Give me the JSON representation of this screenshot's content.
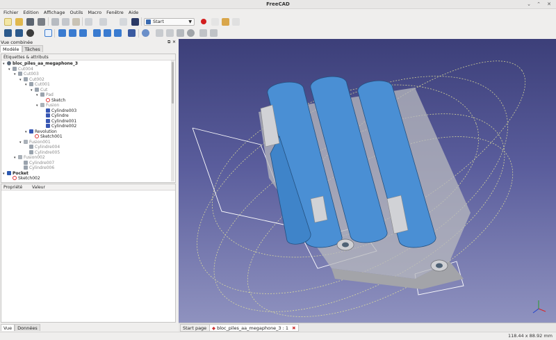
{
  "window": {
    "title": "FreeCAD"
  },
  "menu": [
    "Fichier",
    "Edition",
    "Affichage",
    "Outils",
    "Macro",
    "Fenêtre",
    "Aide"
  ],
  "toolbar": {
    "workbench": "Start"
  },
  "combo_view": {
    "title": "Vue combinée",
    "tabs": [
      "Modèle",
      "Tâches"
    ],
    "tree_header": "Étiquettes & attributs",
    "tree": [
      {
        "label": "bloc_piles_aa_megaphone_3",
        "style": "bold",
        "icon": "doc",
        "twisty": "▾"
      },
      {
        "label": "Cut004",
        "style": "gray",
        "icon": "body",
        "twisty": "▾"
      },
      {
        "label": "Cut003",
        "style": "gray",
        "icon": "body",
        "twisty": "▾"
      },
      {
        "label": "Cut002",
        "style": "gray",
        "icon": "body",
        "twisty": "▾"
      },
      {
        "label": "Cut001",
        "style": "gray",
        "icon": "body",
        "twisty": "▾"
      },
      {
        "label": "Cut",
        "style": "gray",
        "icon": "body",
        "twisty": "▾"
      },
      {
        "label": "Pad",
        "style": "gray",
        "icon": "body",
        "twisty": "▾"
      },
      {
        "label": "Sketch",
        "style": "",
        "icon": "sketch",
        "twisty": ""
      },
      {
        "label": "Fusion",
        "style": "gray",
        "icon": "grayfuse",
        "twisty": "▾"
      },
      {
        "label": "Cylindre003",
        "style": "",
        "icon": "bluebody",
        "twisty": ""
      },
      {
        "label": "Cylindre",
        "style": "",
        "icon": "bluebody",
        "twisty": ""
      },
      {
        "label": "Cylindre001",
        "style": "",
        "icon": "bluebody",
        "twisty": ""
      },
      {
        "label": "Cylindre002",
        "style": "",
        "icon": "bluebody",
        "twisty": ""
      },
      {
        "label": "Revolution",
        "style": "",
        "icon": "bluebody",
        "twisty": "▾"
      },
      {
        "label": "Sketch001",
        "style": "",
        "icon": "sketch",
        "twisty": ""
      },
      {
        "label": "Fusion001",
        "style": "gray",
        "icon": "grayfuse",
        "twisty": "▾"
      },
      {
        "label": "Cylindre004",
        "style": "gray",
        "icon": "body",
        "twisty": ""
      },
      {
        "label": "Cylindre005",
        "style": "gray",
        "icon": "body",
        "twisty": ""
      },
      {
        "label": "Fusion002",
        "style": "gray",
        "icon": "grayfuse",
        "twisty": "▾"
      },
      {
        "label": "Cylindre007",
        "style": "gray",
        "icon": "body",
        "twisty": ""
      },
      {
        "label": "Cylindre006",
        "style": "gray",
        "icon": "body",
        "twisty": ""
      },
      {
        "label": "Pocket",
        "style": "bold",
        "icon": "pocket",
        "twisty": "▾"
      },
      {
        "label": "Sketch002",
        "style": "",
        "icon": "sketch",
        "twisty": ""
      }
    ],
    "property_headers": [
      "Propriété",
      "Valeur"
    ],
    "bottom_tabs": [
      "Vue",
      "Données"
    ]
  },
  "view_tabs": [
    {
      "label": "Start page",
      "active": false
    },
    {
      "label": "bloc_piles_aa_megaphone_3 : 1",
      "active": true
    }
  ],
  "statusbar": {
    "dimensions": "118.44 x 88.92 mm"
  },
  "colors": {
    "viewport_top": "#3c3f79",
    "viewport_bottom": "#8f92bf",
    "battery": "#4a8fd4",
    "shell": "#b8b9be",
    "record": "#d21e1e"
  }
}
